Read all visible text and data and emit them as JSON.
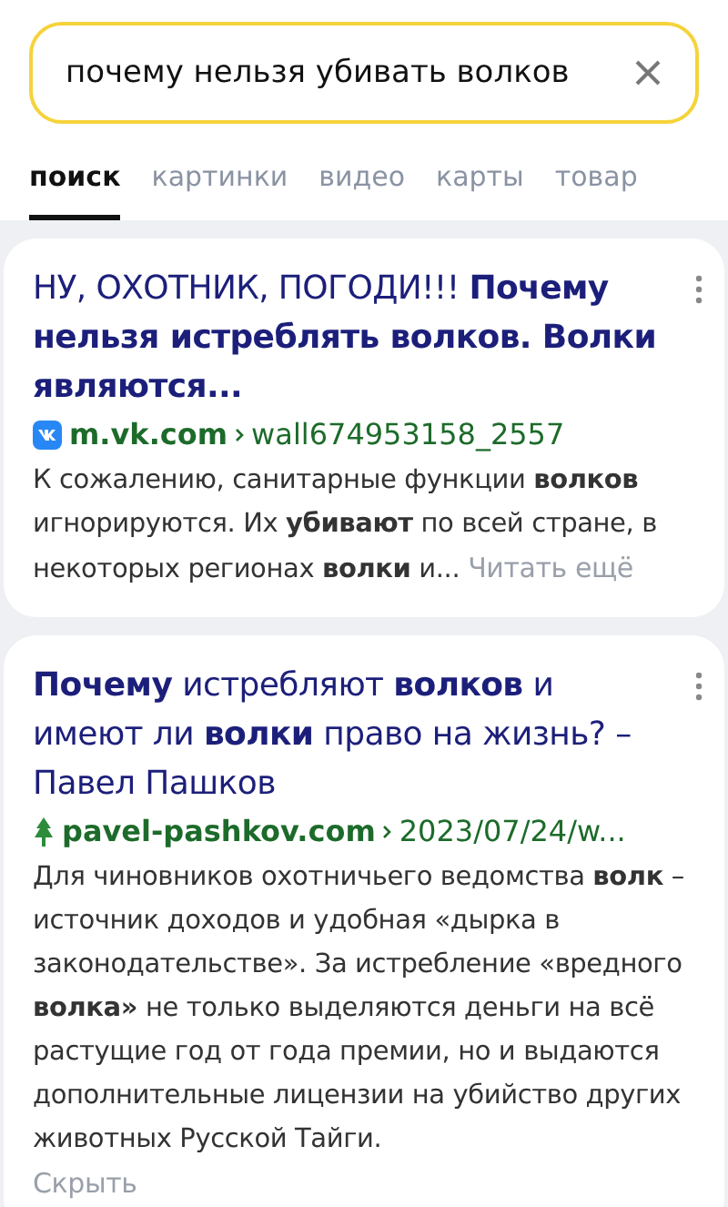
{
  "search": {
    "value": "почему нельзя убивать волков"
  },
  "tabs": [
    {
      "label": "поиск",
      "selected": true
    },
    {
      "label": "картинки",
      "selected": false
    },
    {
      "label": "видео",
      "selected": false
    },
    {
      "label": "карты",
      "selected": false
    },
    {
      "label": "товар",
      "selected": false
    }
  ],
  "results": [
    {
      "title": "НУ, ОХОТНИК, ПОГОДИ!!! **Почему нельзя истреблять волков. Волки являются...**",
      "kind": "vk",
      "domain": "m.vk.com",
      "path": "wall674953158_2557",
      "snippet": "К сожалению, санитарные функции **волков** игнорируются. Их **убивают** по всей стране, в некоторых регионах **волки** и...",
      "link": {
        "text": "Читать ещё",
        "kind": "inline"
      }
    },
    {
      "title": "**Почему** истребляют **волков** и имеют ли **волки** право на жизнь? – Павел Пашков",
      "kind": "tree",
      "domain": "pavel-pashkov.com",
      "path": "2023/07/24/w...",
      "snippet": "Для чиновников охотничьего ведомства **волк** – источник доходов и удобная «дырка в законодательстве». За истребление «вредного **волка»** не только выделяются деньги на всё растущие год от года премии, но и выдаются дополнительные лицензии на убийство других животных Русской Тайги.",
      "link": {
        "text": "Скрыть",
        "kind": "block"
      }
    }
  ]
}
